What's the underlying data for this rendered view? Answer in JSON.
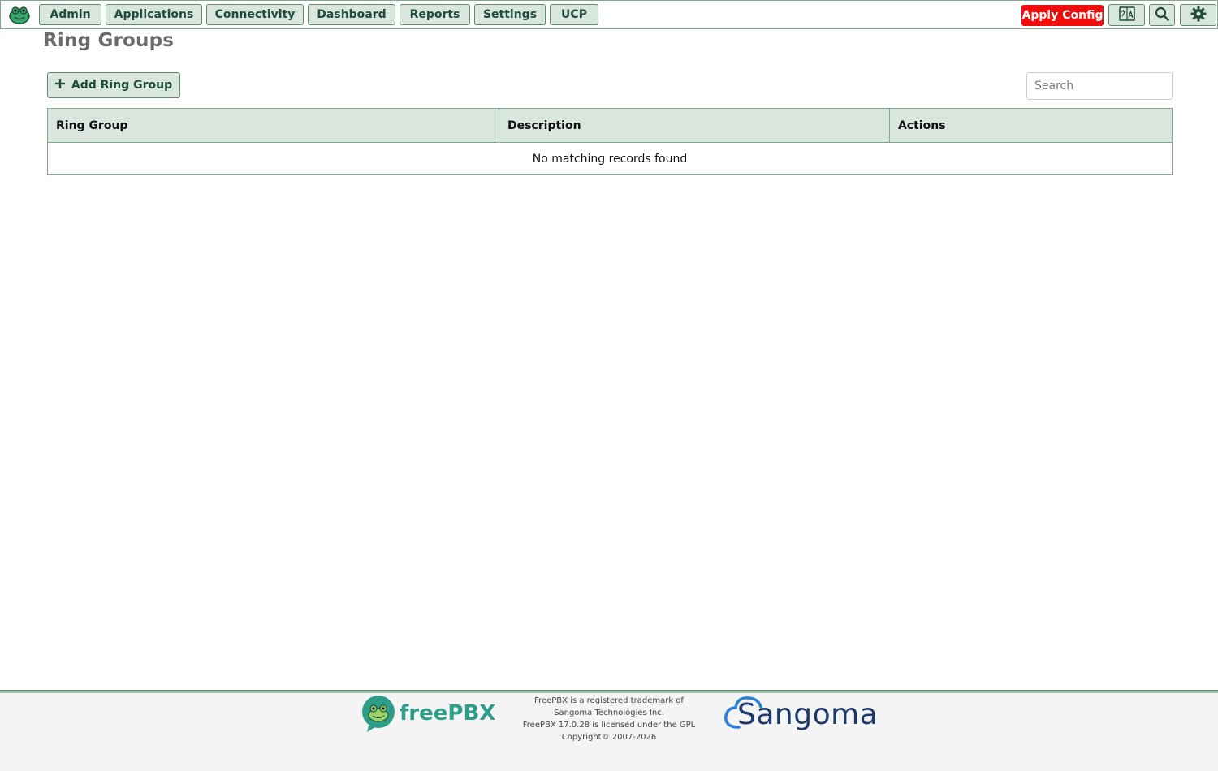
{
  "nav": {
    "items": [
      "Admin",
      "Applications",
      "Connectivity",
      "Dashboard",
      "Reports",
      "Settings",
      "UCP"
    ],
    "apply_label": "Apply Config",
    "icons": [
      "translate-icon",
      "search-icon",
      "gear-icon"
    ]
  },
  "page": {
    "title": "Ring Groups",
    "add_label": "Add Ring Group",
    "search_placeholder": "Search"
  },
  "table": {
    "columns": [
      "Ring Group",
      "Description",
      "Actions"
    ],
    "empty_message": "No matching records found"
  },
  "footer": {
    "logo_text": "freePBX",
    "legal_lines": [
      "FreePBX is a registered trademark of",
      "Sangoma Technologies Inc.",
      "FreePBX 17.0.28 is licensed under the GPL",
      "Copyright© 2007-2026"
    ],
    "brand": "Sangoma"
  },
  "colors": {
    "accent": "#d9e6de",
    "border": "#5e8a6e",
    "apply": "#f20d0d"
  }
}
